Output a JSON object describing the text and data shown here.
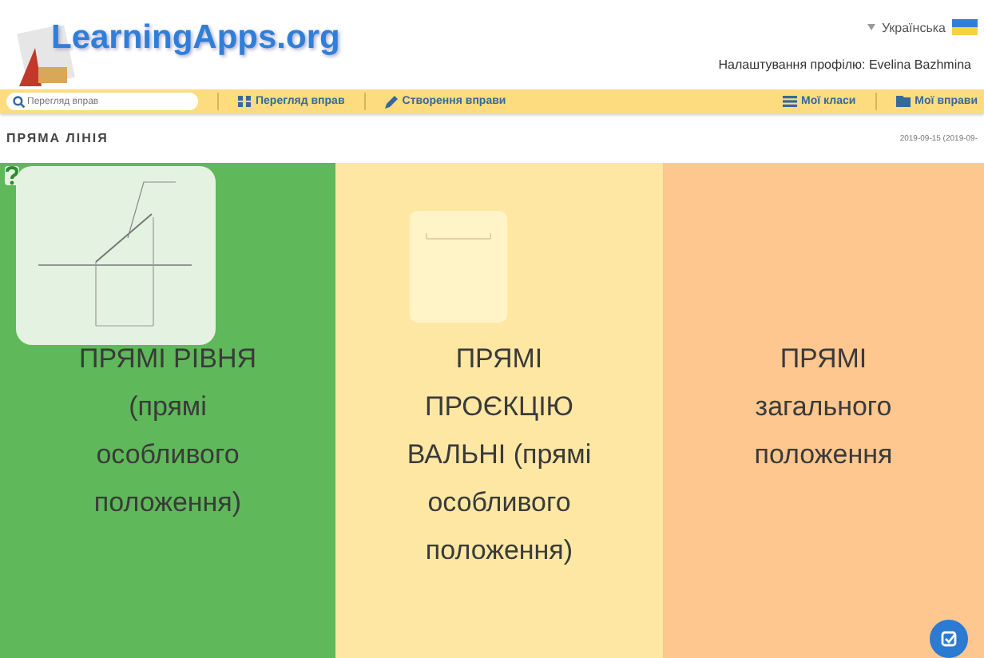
{
  "header": {
    "logo": "LearningApps.org",
    "language": "Українська",
    "profile": "Налаштування профілю: Evelina Bazhmina"
  },
  "nav": {
    "search": {
      "placeholder": "Перегляд вправ"
    },
    "left": [
      {
        "label": "Перегляд вправ"
      },
      {
        "label": "Створення вправи"
      }
    ],
    "right": [
      {
        "label": "Мої класи"
      },
      {
        "label": "Мої вправи"
      }
    ]
  },
  "page": {
    "title": "ПРЯМА ЛІНІЯ",
    "date": "2019-09-15 (2019-09-"
  },
  "columns": [
    {
      "text": "ПРЯМІ РІВНЯ (прямі особливого положення)",
      "color": "#5fb85a"
    },
    {
      "text": "ПРЯМІ ПРОЄКЦІЮ ВАЛЬНІ (прямі особливого положення)",
      "color": "#fde7a3"
    },
    {
      "text": "ПРЯМІ загального положення",
      "color": "#fdc78f"
    }
  ]
}
